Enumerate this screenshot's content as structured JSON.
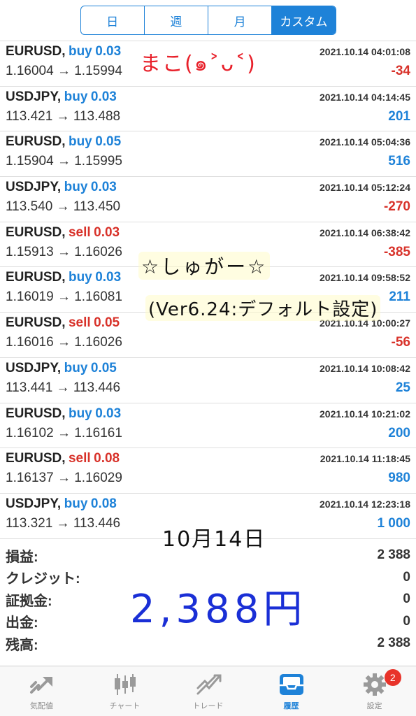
{
  "segment": {
    "items": [
      {
        "label": "日",
        "active": false
      },
      {
        "label": "週",
        "active": false
      },
      {
        "label": "月",
        "active": false
      },
      {
        "label": "カスタム",
        "active": true
      }
    ]
  },
  "trades": [
    {
      "symbol": "EURUSD,",
      "side": "buy",
      "lots": "0.03",
      "datetime": "2021.10.14 04:01:08",
      "prices": "1.16004 → 1.15994",
      "profit": "-34"
    },
    {
      "symbol": "USDJPY,",
      "side": "buy",
      "lots": "0.03",
      "datetime": "2021.10.14 04:14:45",
      "prices": "113.421 → 113.488",
      "profit": "201"
    },
    {
      "symbol": "EURUSD,",
      "side": "buy",
      "lots": "0.05",
      "datetime": "2021.10.14 05:04:36",
      "prices": "1.15904 → 1.15995",
      "profit": "516"
    },
    {
      "symbol": "USDJPY,",
      "side": "buy",
      "lots": "0.03",
      "datetime": "2021.10.14 05:12:24",
      "prices": "113.540 → 113.450",
      "profit": "-270"
    },
    {
      "symbol": "EURUSD,",
      "side": "sell",
      "lots": "0.03",
      "datetime": "2021.10.14 06:38:42",
      "prices": "1.15913 → 1.16026",
      "profit": "-385"
    },
    {
      "symbol": "EURUSD,",
      "side": "buy",
      "lots": "0.03",
      "datetime": "2021.10.14 09:58:52",
      "prices": "1.16019 → 1.16081",
      "profit": "211"
    },
    {
      "symbol": "EURUSD,",
      "side": "sell",
      "lots": "0.05",
      "datetime": "2021.10.14 10:00:27",
      "prices": "1.16016 → 1.16026",
      "profit": "-56"
    },
    {
      "symbol": "USDJPY,",
      "side": "buy",
      "lots": "0.05",
      "datetime": "2021.10.14 10:08:42",
      "prices": "113.441 → 113.446",
      "profit": "25"
    },
    {
      "symbol": "EURUSD,",
      "side": "buy",
      "lots": "0.03",
      "datetime": "2021.10.14 10:21:02",
      "prices": "1.16102 → 1.16161",
      "profit": "200"
    },
    {
      "symbol": "EURUSD,",
      "side": "sell",
      "lots": "0.08",
      "datetime": "2021.10.14 11:18:45",
      "prices": "1.16137 → 1.16029",
      "profit": "980"
    },
    {
      "symbol": "USDJPY,",
      "side": "buy",
      "lots": "0.08",
      "datetime": "2021.10.14 12:23:18",
      "prices": "113.321 → 113.446",
      "profit": "1 000"
    }
  ],
  "summary": [
    {
      "label": "損益:",
      "value": "2 388"
    },
    {
      "label": "クレジット:",
      "value": "0"
    },
    {
      "label": "証拠金:",
      "value": "0"
    },
    {
      "label": "出金:",
      "value": "0"
    },
    {
      "label": "残高:",
      "value": "2 388"
    }
  ],
  "handwriting": {
    "name": "まこ(๑˃ᴗ˂)",
    "sugar": "☆しゅがー☆",
    "version": "(Ver6.24:デフォルト設定)",
    "date": "10月14日",
    "amount": "2,388円"
  },
  "tabs": [
    {
      "label": "気配値",
      "icon": "quotes-icon",
      "active": false,
      "badge": ""
    },
    {
      "label": "チャート",
      "icon": "candlestick-icon",
      "active": false,
      "badge": ""
    },
    {
      "label": "トレード",
      "icon": "trade-icon",
      "active": false,
      "badge": ""
    },
    {
      "label": "履歴",
      "icon": "history-inbox-icon",
      "active": true,
      "badge": ""
    },
    {
      "label": "設定",
      "icon": "gear-icon",
      "active": false,
      "badge": "2"
    }
  ],
  "colors": {
    "accent": "#1e82d8",
    "negative": "#d8322a",
    "handwriting_red": "#e8202a",
    "handwriting_blue": "#1a2fd6",
    "badge": "#e8332a"
  }
}
